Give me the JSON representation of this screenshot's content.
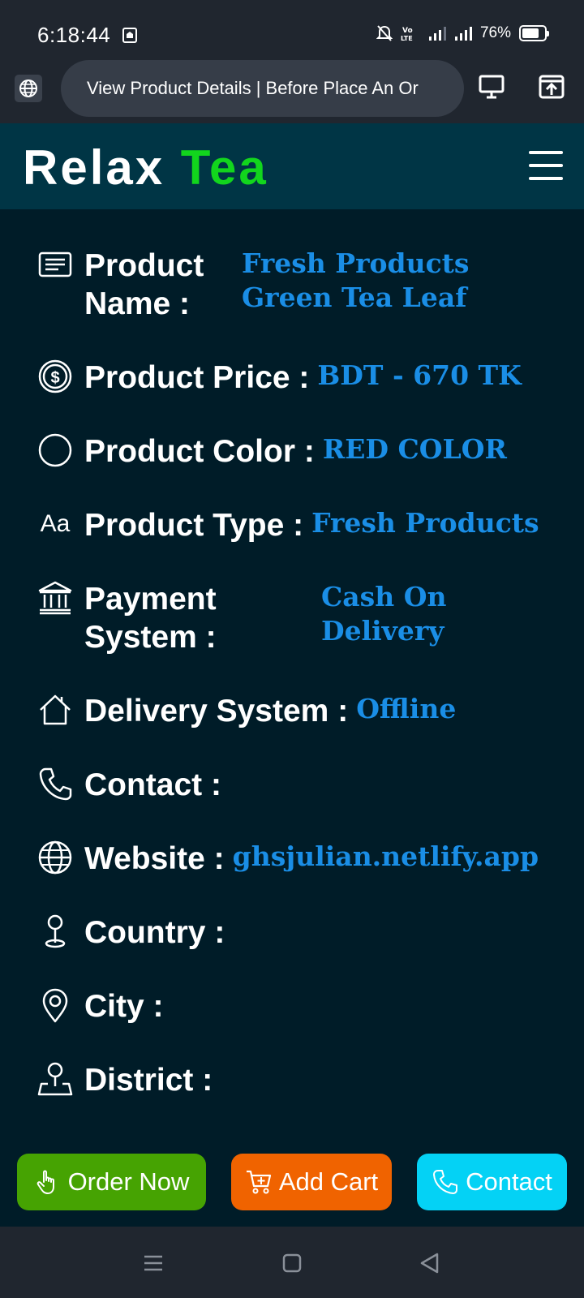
{
  "status": {
    "time": "6:18:44",
    "battery": "76%",
    "battery_level": 0.76
  },
  "browser": {
    "page_title": "View Product Details | Before Place An Or"
  },
  "site": {
    "logo_main": "Relax",
    "logo_accent": "Tea",
    "accent_color": "#12d51d"
  },
  "details": {
    "product_name": {
      "label_line1": "Product",
      "label_line2": "Name :",
      "value_line1": "Fresh Products",
      "value_line2": "Green Tea Leaf",
      "icon": "document-icon"
    },
    "product_price": {
      "label": "Product Price :",
      "value": "BDT - 670 TK",
      "icon": "dollar-icon"
    },
    "product_color": {
      "label": "Product Color :",
      "value": "RED COLOR",
      "icon": "circle-icon"
    },
    "product_type": {
      "label": "Product Type :",
      "value": "Fresh Products",
      "icon_text": "Aa"
    },
    "payment_system": {
      "label_line1": "Payment",
      "label_line2": "System :",
      "value_line1": "Cash On",
      "value_line2": "Delivery",
      "icon": "bank-icon"
    },
    "delivery_system": {
      "label": "Delivery System :",
      "value": "Offline",
      "icon": "home-icon"
    },
    "contact": {
      "label": "Contact :",
      "value": "",
      "icon": "phone-icon"
    },
    "website": {
      "label": "Website :",
      "value": "ghsjulian.netlify.app",
      "icon": "globe-icon"
    },
    "country": {
      "label": "Country :",
      "value": "",
      "icon": "pin-icon"
    },
    "city": {
      "label": "City :",
      "value": "",
      "icon": "location-icon"
    },
    "district": {
      "label": "District :",
      "value": "",
      "icon": "map-pin-icon"
    }
  },
  "actions": {
    "order_label": "Order Now",
    "cart_label": "Add Cart",
    "contact_label": "Contact",
    "order_color": "#46a302",
    "cart_color": "#f06300",
    "contact_color": "#04d2f5"
  }
}
